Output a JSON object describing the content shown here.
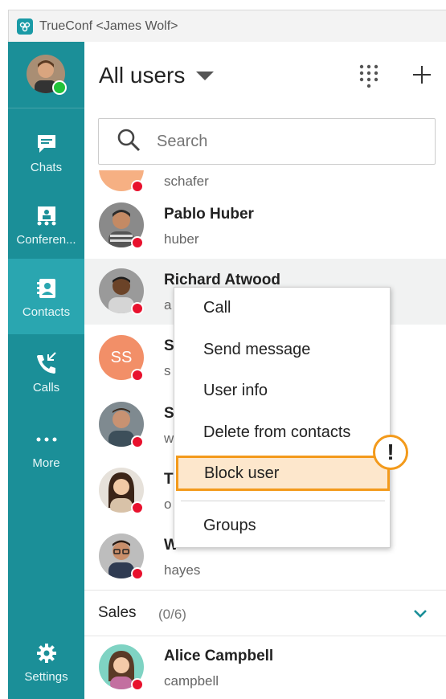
{
  "app": {
    "title": "TrueConf <James Wolf>",
    "accent": "#1b8f98"
  },
  "sidebar": {
    "items": [
      {
        "label": "Chats",
        "icon": "chat-icon"
      },
      {
        "label": "Conferen...",
        "icon": "conference-icon"
      },
      {
        "label": "Contacts",
        "icon": "contacts-icon",
        "active": true
      },
      {
        "label": "Calls",
        "icon": "calls-icon"
      },
      {
        "label": "More",
        "icon": "more-dots-icon"
      },
      {
        "label": "Settings",
        "icon": "gear-icon"
      }
    ]
  },
  "header": {
    "title": "All users"
  },
  "search": {
    "placeholder": "Search"
  },
  "contacts": [
    {
      "login": "schafer",
      "status": "offline"
    },
    {
      "name": "Pablo Huber",
      "login": "huber",
      "status": "offline"
    },
    {
      "name": "Richard Atwood",
      "login": "a",
      "status": "offline"
    },
    {
      "name": "S",
      "login": "s",
      "initials": "SS",
      "status": "offline"
    },
    {
      "name": "S",
      "login": "w",
      "status": "offline"
    },
    {
      "name": "T",
      "login": "o",
      "status": "offline"
    },
    {
      "name": "W",
      "login": "hayes",
      "status": "offline"
    }
  ],
  "group": {
    "name": "Sales",
    "count": "(0/6)"
  },
  "group_contacts": [
    {
      "name": "Alice Campbell",
      "login": "campbell",
      "status": "offline"
    }
  ],
  "context_menu": {
    "items": [
      "Call",
      "Send message",
      "User info",
      "Delete from contacts",
      "Block user",
      "Groups"
    ],
    "highlighted": "Block user",
    "alert_mark": "!"
  }
}
